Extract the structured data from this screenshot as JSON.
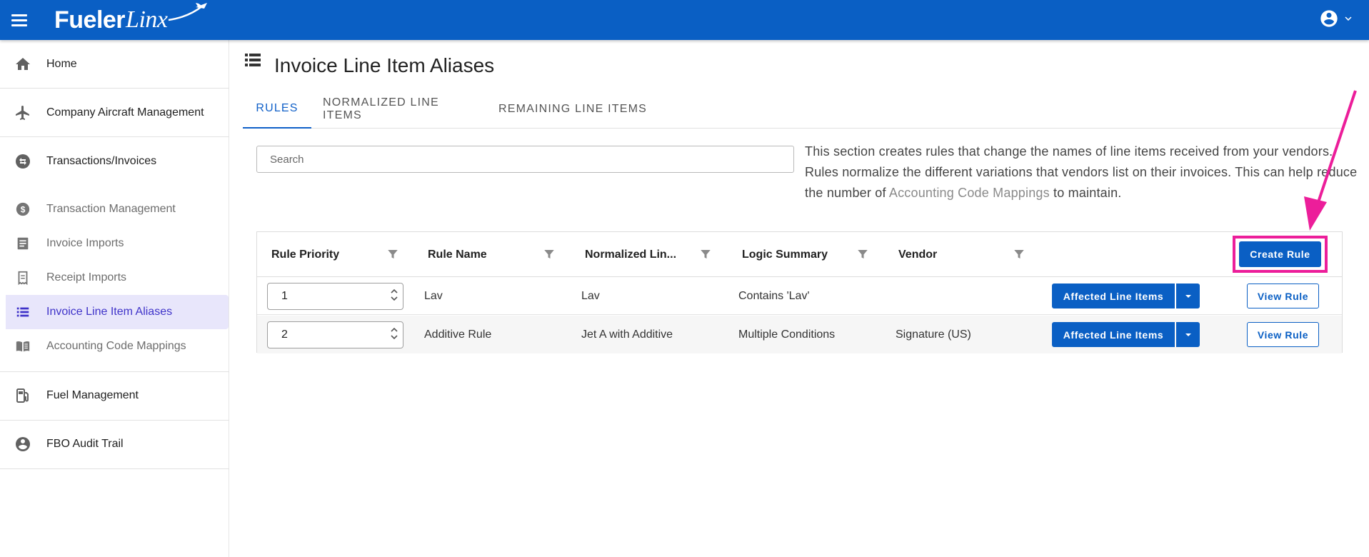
{
  "app": {
    "brand_part1": "Fueler",
    "brand_part2": "Linx"
  },
  "sidebar": {
    "items": [
      {
        "label": "Home",
        "icon": "home-icon"
      },
      {
        "label": "Company Aircraft Management",
        "icon": "airplane-icon"
      },
      {
        "label": "Transactions/Invoices",
        "icon": "swap-icon"
      },
      {
        "label": "Transaction Management",
        "icon": "dollar-icon"
      },
      {
        "label": "Invoice Imports",
        "icon": "document-icon"
      },
      {
        "label": "Receipt Imports",
        "icon": "receipt-icon"
      },
      {
        "label": "Invoice Line Item Aliases",
        "icon": "list-icon"
      },
      {
        "label": "Accounting Code Mappings",
        "icon": "book-icon"
      },
      {
        "label": "Fuel Management",
        "icon": "fuel-pump-icon"
      },
      {
        "label": "FBO Audit Trail",
        "icon": "account-circle-icon"
      }
    ],
    "active_item": "Invoice Line Item Aliases"
  },
  "page": {
    "title": "Invoice Line Item Aliases",
    "tabs": [
      "RULES",
      "NORMALIZED LINE ITEMS",
      "REMAINING LINE ITEMS"
    ],
    "active_tab": "RULES",
    "search_placeholder": "Search",
    "description_before": "This section creates rules that change the names of line items received from your vendors. Rules normalize the different variations that vendors list on their invoices. This can help reduce the number of ",
    "description_link": "Accounting Code Mappings",
    "description_after": " to maintain."
  },
  "grid": {
    "columns": [
      "Rule Priority",
      "Rule Name",
      "Normalized Lin...",
      "Logic Summary",
      "Vendor"
    ],
    "create_button": "Create Rule",
    "affected_button": "Affected Line Items",
    "view_button": "View Rule",
    "rows": [
      {
        "priority": "1",
        "rule_name": "Lav",
        "normalized": "Lav",
        "logic": "Contains 'Lav'",
        "vendor": ""
      },
      {
        "priority": "2",
        "rule_name": "Additive Rule",
        "normalized": "Jet A with Additive",
        "logic": "Multiple Conditions",
        "vendor": "Signature (US)"
      }
    ]
  },
  "colors": {
    "primary": "#0a5fc4",
    "annotation": "#ec1e9a",
    "active_nav_bg": "#e8e6fb",
    "active_nav_text": "#3f33c9"
  }
}
